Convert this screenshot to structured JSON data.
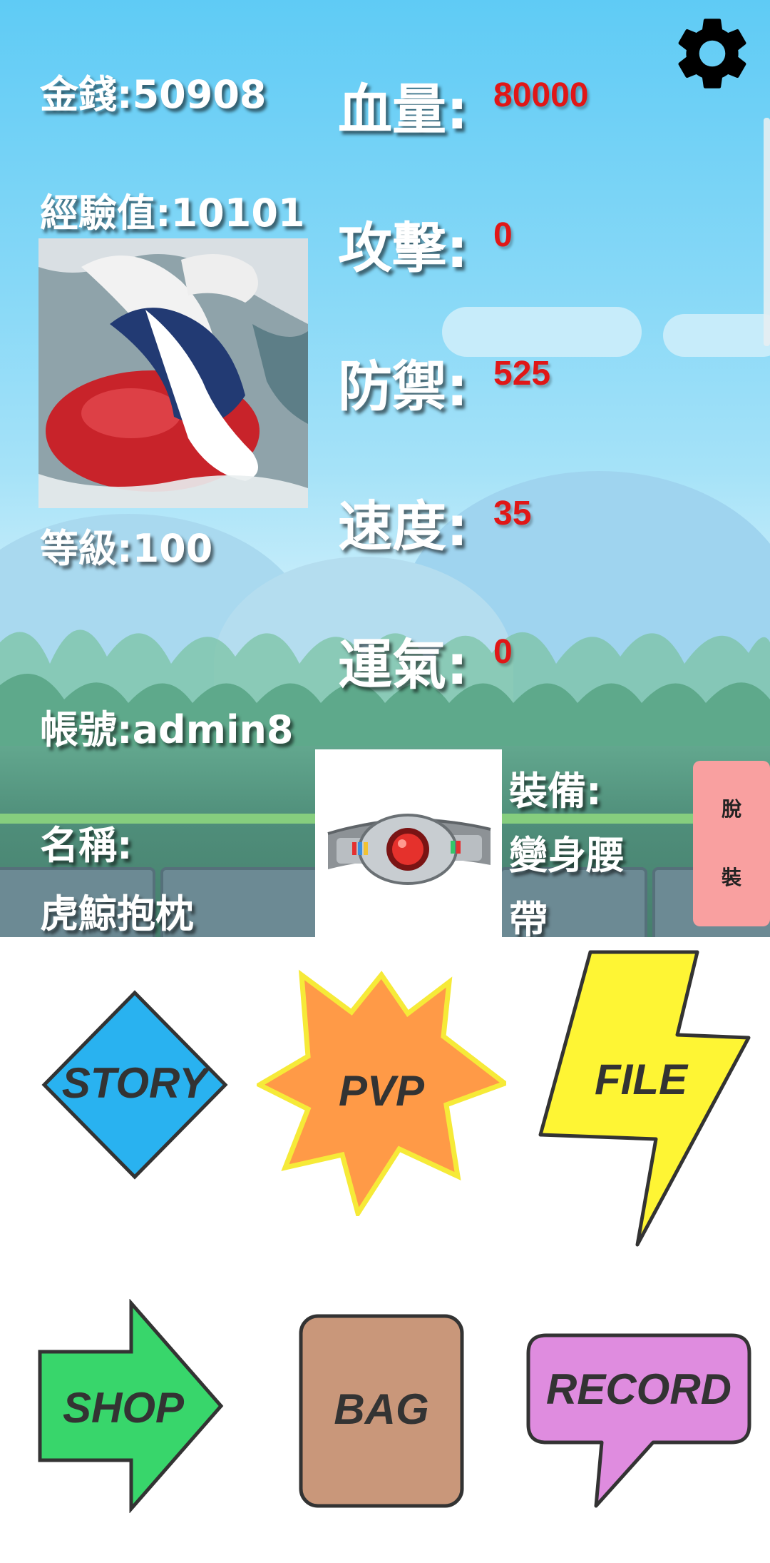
{
  "player": {
    "money": "金錢:50908",
    "exp": "經驗值:10101",
    "level": "等級:100",
    "account": "帳號:admin8",
    "name_label": "名稱:",
    "name_value": "虎鯨抱枕"
  },
  "stats": [
    {
      "label": "血量:",
      "value": "80000"
    },
    {
      "label": "攻擊:",
      "value": "0"
    },
    {
      "label": "防禦:",
      "value": "525"
    },
    {
      "label": "速度:",
      "value": "35"
    },
    {
      "label": "運氣:",
      "value": "0"
    }
  ],
  "equipment": {
    "label": "裝備:",
    "line1": "變身腰",
    "line2": "帶",
    "unequip_char1": "脫",
    "unequip_char2": "裝"
  },
  "menu": {
    "story": "STORY",
    "pvp": "PVP",
    "file": "FILE",
    "shop": "SHOP",
    "bag": "BAG",
    "record": "RECORD"
  },
  "colors": {
    "stat_value": "#e01717",
    "story": "#29b2f0",
    "pvp": "#ff9a47",
    "file": "#fef534",
    "shop": "#38d66b",
    "bag": "#c9977a",
    "record": "#df8cdf",
    "unequip": "#f9a0a0"
  },
  "icons": {
    "settings": "gear-icon"
  }
}
